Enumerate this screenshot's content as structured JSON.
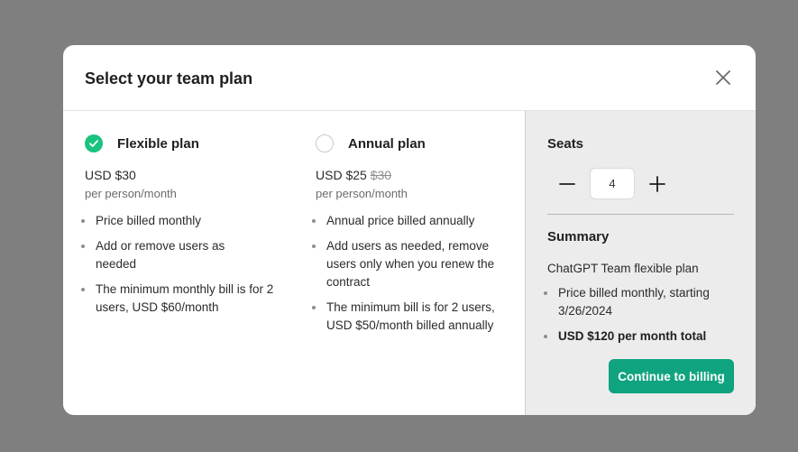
{
  "modal": {
    "title": "Select your team plan"
  },
  "plans": {
    "flexible": {
      "name": "Flexible plan",
      "selected": true,
      "price": "USD $30",
      "per": "per person/month",
      "features": [
        "Price billed monthly",
        "Add or remove users as needed",
        "The minimum monthly bill is for 2 users, USD $60/month"
      ]
    },
    "annual": {
      "name": "Annual plan",
      "selected": false,
      "price": "USD $25",
      "price_strikethrough": "$30",
      "per": "per person/month",
      "features": [
        "Annual price billed annually",
        "Add users as needed, remove users only when you renew the contract",
        "The minimum bill is for 2 users, USD $50/month billed annually"
      ]
    }
  },
  "seats": {
    "title": "Seats",
    "value": "4"
  },
  "summary": {
    "title": "Summary",
    "plan": "ChatGPT Team flexible plan",
    "items": [
      "Price billed monthly, starting 3/26/2024",
      "USD $120 per month total"
    ]
  },
  "actions": {
    "continue_label": "Continue to billing"
  },
  "colors": {
    "accent": "#10a37f",
    "check": "#19c37d",
    "backdrop": "#7f7f7f",
    "sidebar": "#ececec"
  },
  "icons": {
    "close": "close-icon",
    "check": "check-icon",
    "minus": "minus-icon",
    "plus": "plus-icon"
  }
}
